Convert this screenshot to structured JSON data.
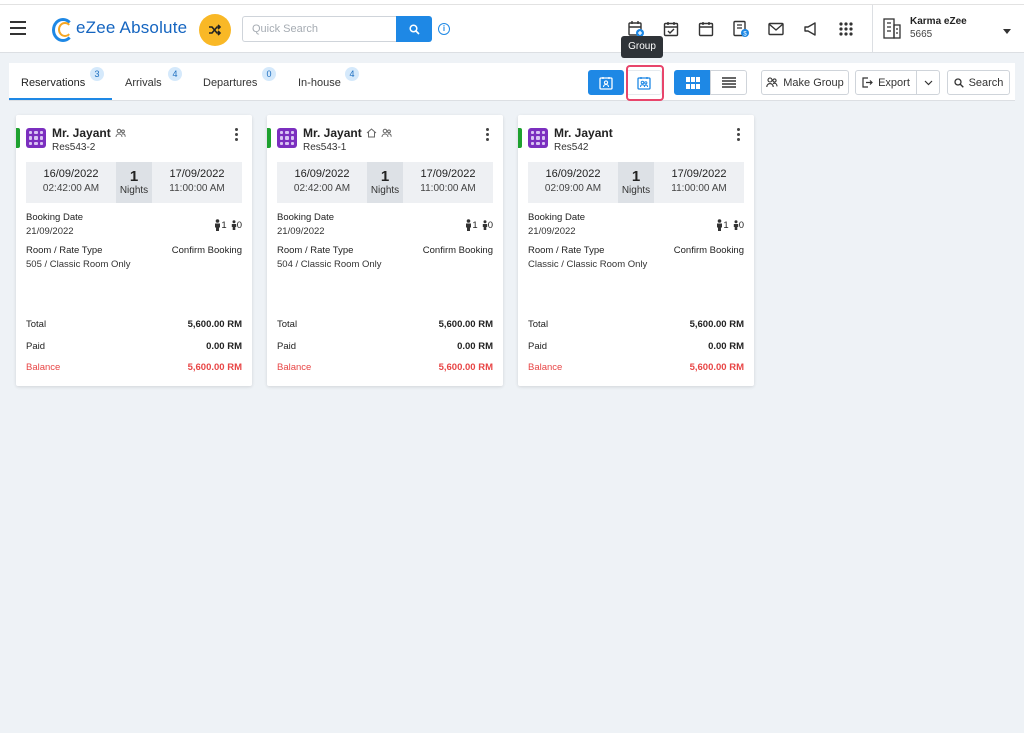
{
  "app": {
    "name": "eZee Absolute"
  },
  "search": {
    "placeholder": "Quick Search"
  },
  "user": {
    "name": "Karma eZee",
    "id": "5665"
  },
  "tabs": [
    {
      "label": "Reservations",
      "count": "3"
    },
    {
      "label": "Arrivals",
      "count": "4"
    },
    {
      "label": "Departures",
      "count": "0"
    },
    {
      "label": "In-house",
      "count": "4"
    }
  ],
  "toolbar": {
    "tooltip": "Group",
    "make_group": "Make Group",
    "export": "Export",
    "search": "Search"
  },
  "labels": {
    "nights": "Nights",
    "booking_date": "Booking Date",
    "room_rate_type": "Room / Rate Type",
    "total": "Total",
    "paid": "Paid",
    "balance": "Balance"
  },
  "cards": [
    {
      "guest": "Mr. Jayant",
      "res_no": "Res543-2",
      "arrival_date": "16/09/2022",
      "arrival_time": "02:42:00 AM",
      "nights": "1",
      "departure_date": "17/09/2022",
      "departure_time": "11:00:00 AM",
      "booking_date": "21/09/2022",
      "adults": "1",
      "children": "0",
      "room_rate": "505 / Classic Room Only",
      "status": "Confirm Booking",
      "total": "5,600.00 RM",
      "paid": "0.00 RM",
      "balance": "5,600.00 RM"
    },
    {
      "guest": "Mr. Jayant",
      "res_no": "Res543-1",
      "arrival_date": "16/09/2022",
      "arrival_time": "02:42:00 AM",
      "nights": "1",
      "departure_date": "17/09/2022",
      "departure_time": "11:00:00 AM",
      "booking_date": "21/09/2022",
      "adults": "1",
      "children": "0",
      "room_rate": "504 / Classic Room Only",
      "status": "Confirm Booking",
      "total": "5,600.00 RM",
      "paid": "0.00 RM",
      "balance": "5,600.00 RM"
    },
    {
      "guest": "Mr. Jayant",
      "res_no": "Res542",
      "arrival_date": "16/09/2022",
      "arrival_time": "02:09:00 AM",
      "nights": "1",
      "departure_date": "17/09/2022",
      "departure_time": "11:00:00 AM",
      "booking_date": "21/09/2022",
      "adults": "1",
      "children": "0",
      "room_rate": "Classic / Classic Room Only",
      "status": "Confirm Booking",
      "total": "5,600.00 RM",
      "paid": "0.00 RM",
      "balance": "5,600.00 RM"
    }
  ],
  "colors": {
    "primary": "#1e88e5",
    "accent": "#f9b826",
    "highlight": "#e8456b",
    "balance": "#e84545",
    "status_strip": "#1ea12f",
    "room_icon": "#7b2fbf"
  }
}
